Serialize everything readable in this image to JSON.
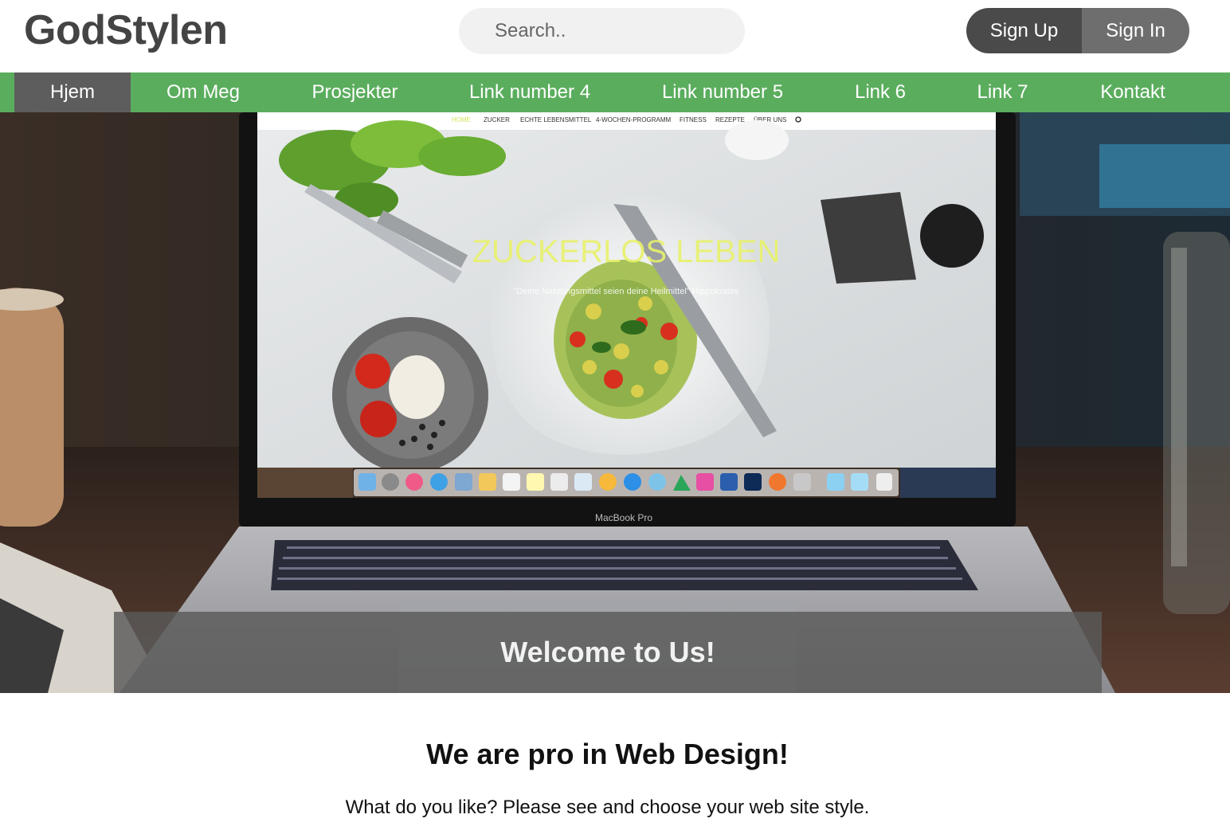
{
  "header": {
    "logo": "GodStylen",
    "search_placeholder": "Search..",
    "sign_up": "Sign Up",
    "sign_in": "Sign In"
  },
  "nav": {
    "items": [
      {
        "label": "Hjem",
        "active": true
      },
      {
        "label": "Om Meg"
      },
      {
        "label": "Prosjekter"
      },
      {
        "label": "Link number 4"
      },
      {
        "label": "Link number 5"
      },
      {
        "label": "Link 6"
      },
      {
        "label": "Link 7"
      },
      {
        "label": "Kontakt"
      }
    ]
  },
  "hero": {
    "welcome": "Welcome to Us!",
    "laptop_screen": {
      "menu": [
        "HOME",
        "ZUCKER",
        "ECHTE LEBENSMITTEL",
        "4-WOCHEN-PROGRAMM",
        "FITNESS",
        "REZEPTE",
        "ÜBER UNS"
      ],
      "title": "ZUCKERLOS LEBEN",
      "quote": "\"Deine Nahrungsmittel seien deine Heilmittel\" Hippokrates",
      "brand": "MacBook Pro"
    }
  },
  "content": {
    "headline": "We are pro in Web Design!",
    "subline": "What do you like? Please see and choose your web site style."
  },
  "colors": {
    "nav_green": "#5bad5e",
    "nav_active": "#5d5d5d",
    "sign_up_bg": "#4a4a4a",
    "sign_in_bg": "#6e6e6e",
    "logo": "#444444",
    "screen_title": "#e8f26a"
  }
}
